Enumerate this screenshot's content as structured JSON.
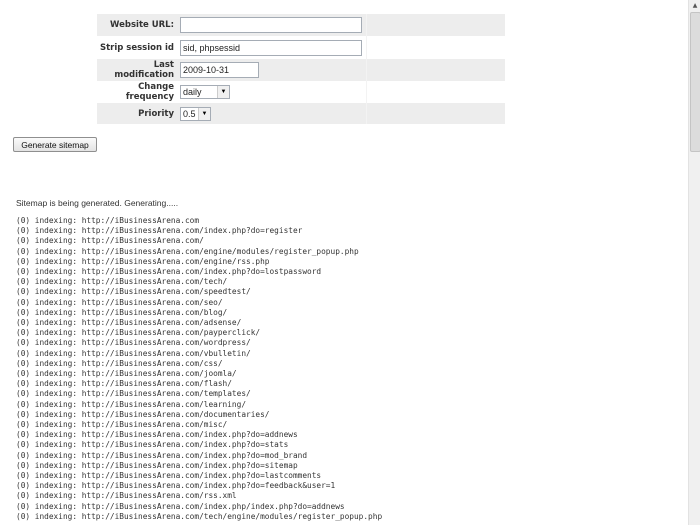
{
  "form": {
    "website_url": {
      "label": "Website URL:",
      "value": ""
    },
    "strip_session": {
      "label": "Strip session id",
      "value": "sid, phpsessid"
    },
    "last_modification": {
      "label": "Last modification",
      "value": "2009-10-31"
    },
    "change_frequency": {
      "label": "Change frequency",
      "value": "daily"
    },
    "priority": {
      "label": "Priority",
      "value": "0.5"
    }
  },
  "generate_button": "Generate sitemap",
  "status": "Sitemap is being generated. Generating.....",
  "log": [
    "(0) indexing: http://iBusinessArena.com",
    "(0) indexing: http://iBusinessArena.com/index.php?do=register",
    "(0) indexing: http://iBusinessArena.com/",
    "(0) indexing: http://iBusinessArena.com/engine/modules/register_popup.php",
    "(0) indexing: http://iBusinessArena.com/engine/rss.php",
    "(0) indexing: http://iBusinessArena.com/index.php?do=lostpassword",
    "(0) indexing: http://iBusinessArena.com/tech/",
    "(0) indexing: http://iBusinessArena.com/speedtest/",
    "(0) indexing: http://iBusinessArena.com/seo/",
    "(0) indexing: http://iBusinessArena.com/blog/",
    "(0) indexing: http://iBusinessArena.com/adsense/",
    "(0) indexing: http://iBusinessArena.com/payperclick/",
    "(0) indexing: http://iBusinessArena.com/wordpress/",
    "(0) indexing: http://iBusinessArena.com/vbulletin/",
    "(0) indexing: http://iBusinessArena.com/css/",
    "(0) indexing: http://iBusinessArena.com/joomla/",
    "(0) indexing: http://iBusinessArena.com/flash/",
    "(0) indexing: http://iBusinessArena.com/templates/",
    "(0) indexing: http://iBusinessArena.com/learning/",
    "(0) indexing: http://iBusinessArena.com/documentaries/",
    "(0) indexing: http://iBusinessArena.com/misc/",
    "(0) indexing: http://iBusinessArena.com/index.php?do=addnews",
    "(0) indexing: http://iBusinessArena.com/index.php?do=stats",
    "(0) indexing: http://iBusinessArena.com/index.php?do=mod_brand",
    "(0) indexing: http://iBusinessArena.com/index.php?do=sitemap",
    "(0) indexing: http://iBusinessArena.com/index.php?do=lastcomments",
    "(0) indexing: http://iBusinessArena.com/index.php?do=feedback&user=1",
    "(0) indexing: http://iBusinessArena.com/rss.xml",
    "(0) indexing: http://iBusinessArena.com/index.php/index.php?do=addnews",
    "(0) indexing: http://iBusinessArena.com/tech/engine/modules/register_popup.php"
  ]
}
